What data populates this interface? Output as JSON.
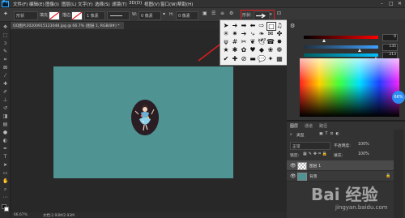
{
  "menubar": {
    "items": [
      "文件(F)",
      "编辑(E)",
      "图像(I)",
      "图层(L)",
      "文字(Y)",
      "选择(S)",
      "滤镜(T)",
      "3D(D)",
      "视图(V)",
      "窗口(W)",
      "帮助(H)"
    ]
  },
  "options": {
    "shape_label": "形状",
    "fill_label": "填充",
    "stroke_label": "描边",
    "stroke_width": "1 像素",
    "w_label": "W:",
    "w_value": "0 像素",
    "h_label": "H:",
    "h_value": "0 像素",
    "shape_field_label": "形状:"
  },
  "document": {
    "tab_title": "QQ图片20200915123048.jpg @ 66.7% (图层 1, RGB/8#) *"
  },
  "status": {
    "zoom": "66.67%",
    "doc_size": "文档:2.93M/2.93M"
  },
  "color_panel": {
    "r_value": "0",
    "g_value": "135",
    "b_value": "213",
    "badge": "66%"
  },
  "layers_panel": {
    "tabs": [
      "图层",
      "通道",
      "路径"
    ],
    "kind_label": "类型",
    "blend_mode": "正常",
    "opacity_label": "不透明度:",
    "opacity_value": "100%",
    "lock_label": "锁定:",
    "fill_label": "填充:",
    "fill_value": "100%",
    "layers": [
      {
        "name": "图层 1"
      },
      {
        "name": "背景"
      }
    ]
  },
  "watermark": {
    "text": "Bai 经验",
    "url": "jingyan.baidu.com"
  },
  "colors": {
    "accent": "#2c8cf0",
    "highlight": "#e02020",
    "canvas_fill": "#4f9393"
  }
}
